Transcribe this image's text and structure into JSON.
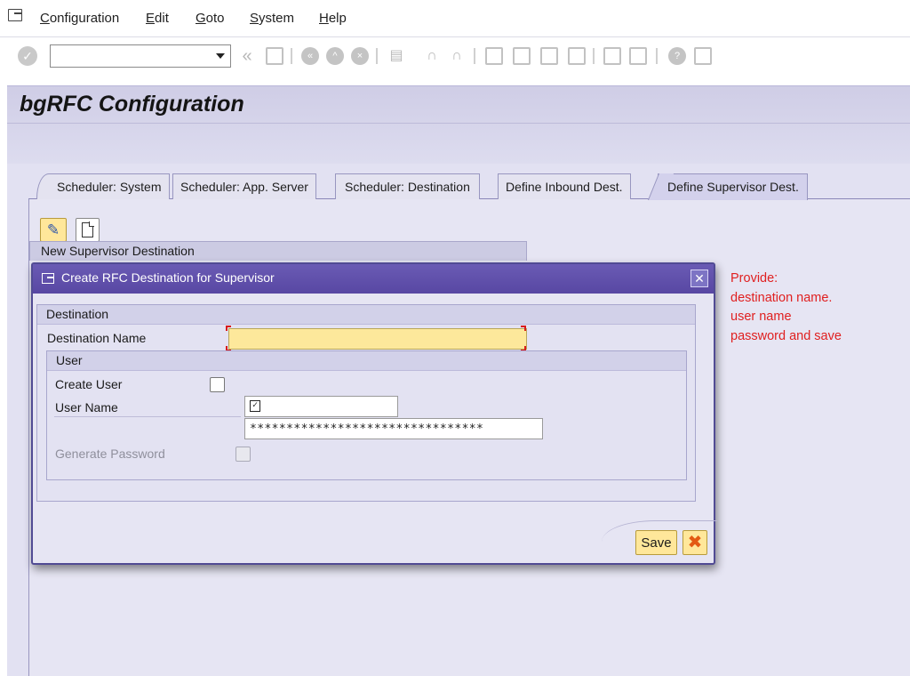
{
  "menubar": {
    "items": [
      {
        "label": "Configuration",
        "underline": "C",
        "rest": "onfiguration"
      },
      {
        "label": "Edit",
        "underline": "E",
        "rest": "dit"
      },
      {
        "label": "Goto",
        "underline": "G",
        "rest": "oto"
      },
      {
        "label": "System",
        "underline": "S",
        "rest": "ystem"
      },
      {
        "label": "Help",
        "underline": "H",
        "rest": "elp"
      }
    ]
  },
  "toolbar": {
    "command_field": {
      "value": "",
      "placeholder": ""
    },
    "icons": [
      "enter-icon",
      "back-icon",
      "save-icon",
      "back-nav-icon",
      "exit-icon",
      "cancel-icon",
      "print-icon",
      "find-icon",
      "find-next-icon",
      "first-page-icon",
      "previous-page-icon",
      "next-page-icon",
      "last-page-icon",
      "create-session-icon",
      "shortcut-icon",
      "help-icon",
      "customize-layout-icon"
    ]
  },
  "page": {
    "title": "bgRFC Configuration"
  },
  "tabs": [
    {
      "label": "Scheduler: System",
      "active": false
    },
    {
      "label": "Scheduler: App. Server",
      "active": false
    },
    {
      "label": "Scheduler: Destination",
      "active": false
    },
    {
      "label": "Define Inbound Dest.",
      "active": false
    },
    {
      "label": "Define Supervisor Dest.",
      "active": true
    }
  ],
  "tab_content": {
    "edit_icon": "pencil-icon",
    "new_icon": "new-document-icon",
    "group_title": "New Supervisor Destination"
  },
  "dialog": {
    "title": "Create RFC Destination for Supervisor",
    "destination_section": "Destination",
    "destination_name_label": "Destination Name",
    "destination_name_value": "",
    "user_section": "User",
    "create_user_label": "Create User",
    "create_user_checked": false,
    "user_name_label": "User Name",
    "user_name_value": "",
    "password_value": "********************************",
    "generate_password_label": "Generate Password",
    "generate_password_checked": false,
    "save_label": "Save",
    "cancel_icon": "cancel-x-icon",
    "close_icon": "close-icon"
  },
  "annotation": {
    "lines": [
      "Provide:",
      "destination name.",
      "user name",
      "password and save"
    ],
    "color": "#e02020"
  },
  "colors": {
    "dialog_titlebar": "#5a49a6",
    "button_yellow": "#ffe79a",
    "required_field": "#fde89b",
    "content_bg": "#e2e1f2"
  }
}
